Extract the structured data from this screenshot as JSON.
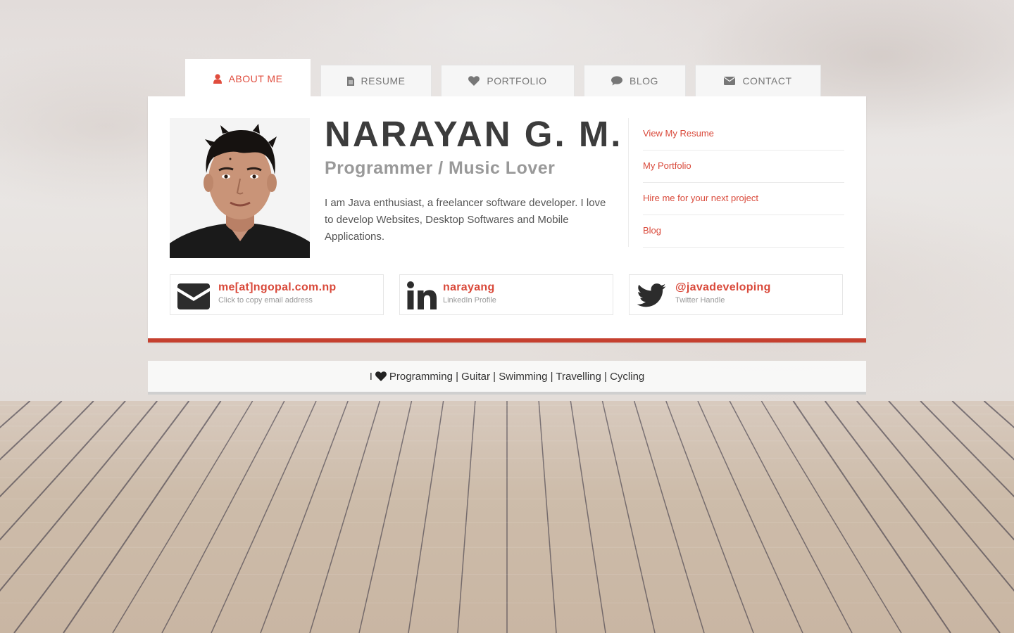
{
  "tabs": [
    {
      "label": "About Me",
      "icon": "user-icon",
      "active": true
    },
    {
      "label": "Resume",
      "icon": "file-icon"
    },
    {
      "label": "Portfolio",
      "icon": "heart-icon"
    },
    {
      "label": "Blog",
      "icon": "comment-icon"
    },
    {
      "label": "Contact",
      "icon": "envelope-icon"
    }
  ],
  "profile": {
    "name": "NARAYAN G. M.",
    "subtitle": "Programmer / Music Lover",
    "bio": "I am Java enthusiast, a freelancer software developer. I love to develop Websites, Desktop Softwares and Mobile Applications."
  },
  "links": [
    "View My Resume",
    "My Portfolio",
    "Hire me for your next project",
    "Blog"
  ],
  "social": [
    {
      "main": "me[at]ngopal.com.np",
      "sub": "Click to copy email address",
      "icon": "envelope-icon"
    },
    {
      "main": "narayang",
      "sub": "LinkedIn Profile",
      "icon": "linkedin-icon"
    },
    {
      "main": "@javadeveloping",
      "sub": "Twitter Handle",
      "icon": "twitter-icon"
    }
  ],
  "footer": {
    "prefix": "I",
    "text": "Programming | Guitar | Swimming | Travelling | Cycling",
    "icon": "heart-icon"
  },
  "colors": {
    "accent": "#d9493a",
    "accent_dark": "#c5402f",
    "text_dark": "#3c3c3c"
  }
}
